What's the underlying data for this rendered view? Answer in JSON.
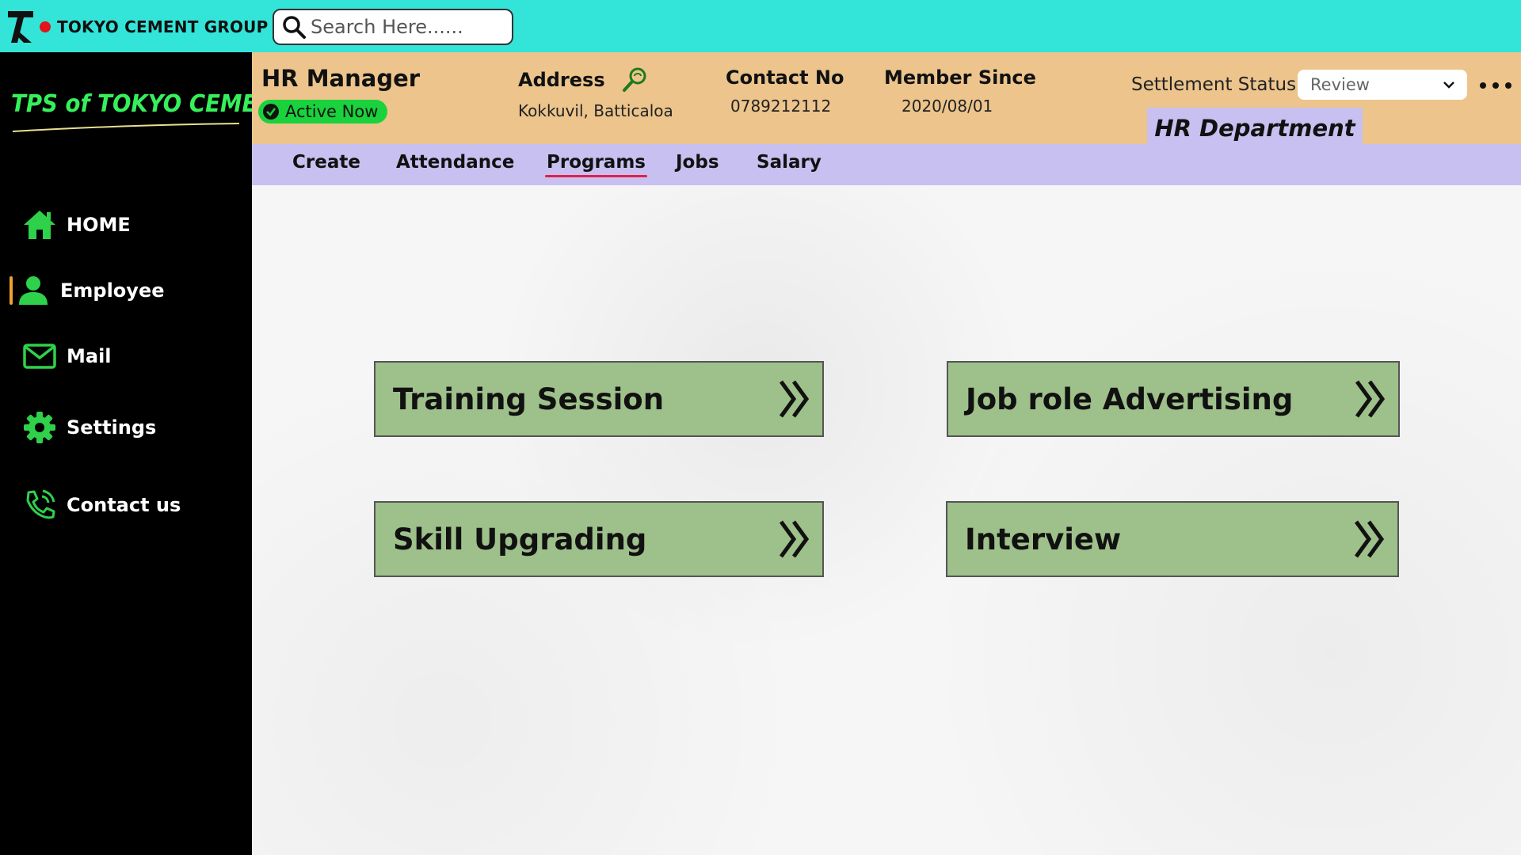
{
  "topbar": {
    "brand_name": "TOKYO CEMENT GROUP",
    "search_placeholder": "Search Here......"
  },
  "sidebar": {
    "title": "TPS of TOKYO CEMENT",
    "items": [
      {
        "label": "HOME",
        "icon": "home-icon"
      },
      {
        "label": "Employee",
        "icon": "user-icon",
        "active": true
      },
      {
        "label": "Mail",
        "icon": "mail-icon"
      },
      {
        "label": "Settings",
        "icon": "gear-icon"
      },
      {
        "label": "Contact us",
        "icon": "phone-icon"
      }
    ]
  },
  "header": {
    "role": "HR Manager",
    "status": "Active Now",
    "address_label": "Address",
    "address_value": "Kokkuvil, Batticaloa",
    "contact_label": "Contact No",
    "contact_value": "0789212112",
    "member_label": "Member Since",
    "member_value": "2020/08/01",
    "settlement_label": "Settlement Status",
    "settlement_value": "Review",
    "department": "HR Department"
  },
  "tabs": [
    {
      "label": "Create"
    },
    {
      "label": "Attendance"
    },
    {
      "label": "Programs",
      "active": true
    },
    {
      "label": "Jobs"
    },
    {
      "label": "Salary"
    }
  ],
  "cards": [
    {
      "label": "Training Session"
    },
    {
      "label": "Job role Advertising"
    },
    {
      "label": "Skill Upgrading"
    },
    {
      "label": "Interview"
    }
  ],
  "colors": {
    "topbar": "#33e5d9",
    "sidebar": "#000000",
    "accent_green": "#35f05a",
    "info_band": "#ecc48c",
    "tabs_bar": "#c7c0f0",
    "card": "#9ec08a",
    "active_badge": "#19d23c",
    "tab_underline": "#e0204a"
  }
}
